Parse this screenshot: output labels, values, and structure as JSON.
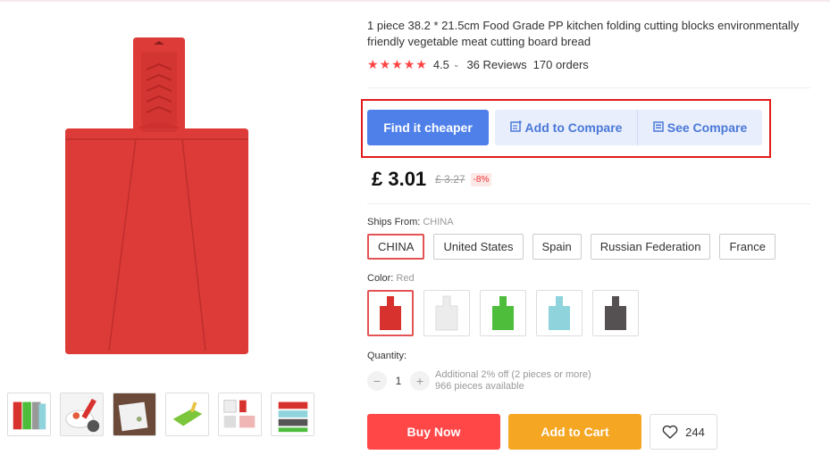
{
  "product": {
    "title": "1 piece 38.2 * 21.5cm Food Grade PP kitchen folding cutting blocks environmentally friendly vegetable meat cutting board bread",
    "rating": "4.5",
    "stars": 5,
    "reviews": "36 Reviews",
    "orders": "170 orders"
  },
  "compare": {
    "find_cheaper": "Find it cheaper",
    "add_to_compare": "Add to Compare",
    "see_compare": "See Compare"
  },
  "price": {
    "current": "£ 3.01",
    "original": "£ 3.27",
    "discount": "-8%"
  },
  "shipping": {
    "label": "Ships From:",
    "selected": "CHINA",
    "options": [
      "CHINA",
      "United States",
      "Spain",
      "Russian Federation",
      "France"
    ]
  },
  "color": {
    "label": "Color:",
    "selected": "Red",
    "swatches": [
      "#d8322f",
      "#ececec",
      "#4dbd3b",
      "#8fd3dc",
      "#555152"
    ]
  },
  "quantity": {
    "label": "Quantity:",
    "value": "1",
    "note_line1": "Additional 2% off (2 pieces or more)",
    "note_line2": "966 pieces available"
  },
  "actions": {
    "buy_now": "Buy Now",
    "add_to_cart": "Add to Cart",
    "wishlist_count": "244"
  },
  "colors": {
    "board_red": "#dd3b38",
    "accent_blue": "#4f80ea",
    "buy_red": "#ff4747",
    "cart_orange": "#f5a623",
    "highlight_red": "#e21b1b"
  }
}
